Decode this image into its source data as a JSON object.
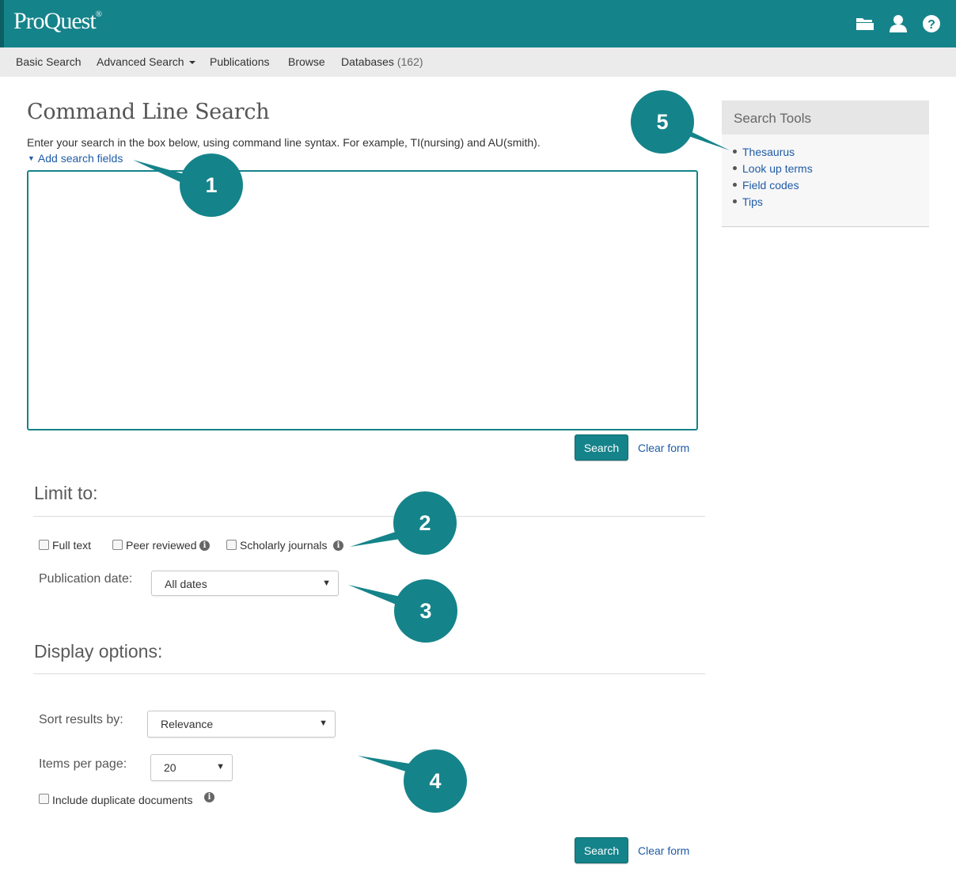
{
  "header": {
    "logo_text": "ProQuest",
    "logo_mark": "®",
    "icons": [
      "folder-icon",
      "user-icon",
      "help-icon"
    ],
    "brand_color": "#15838a"
  },
  "nav": {
    "basic_search": "Basic Search",
    "advanced_search": "Advanced Search",
    "publications": "Publications",
    "browse": "Browse",
    "databases": "Databases",
    "databases_count": "(162)"
  },
  "main": {
    "title": "Command Line Search",
    "instructions": "Enter your search in the box below, using command line syntax. For example, TI(nursing) and AU(smith).",
    "add_fields": "Add search fields",
    "search_label": "Search",
    "clear_label": "Clear form"
  },
  "limit": {
    "heading": "Limit to:",
    "full_text": "Full text",
    "peer_reviewed": "Peer reviewed",
    "scholarly": "Scholarly journals",
    "pub_date_label": "Publication date:",
    "pub_date_value": "All dates"
  },
  "display": {
    "heading": "Display options:",
    "sort_label": "Sort results by:",
    "sort_value": "Relevance",
    "items_label": "Items per page:",
    "items_value": "20",
    "duplicates": "Include duplicate documents"
  },
  "tools": {
    "heading": "Search Tools",
    "items": [
      "Thesaurus",
      "Look up terms",
      "Field codes",
      "Tips"
    ]
  },
  "callouts": [
    "1",
    "2",
    "3",
    "4",
    "5"
  ]
}
